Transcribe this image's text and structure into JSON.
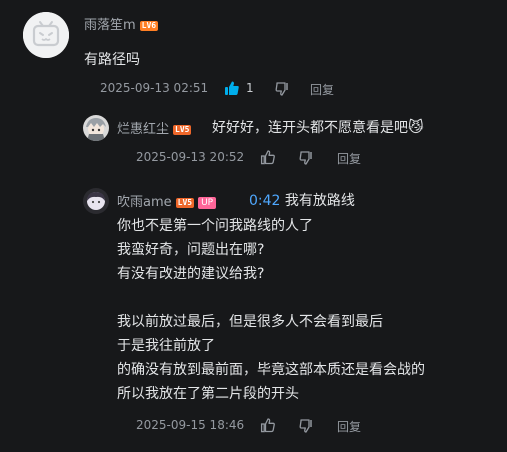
{
  "colors": {
    "background": "#17181a",
    "text": "#e3e5e7",
    "meta": "#9499a0",
    "link": "#4fa8ff",
    "like_active": "#00aeec",
    "up_badge": "#ff6699"
  },
  "comment": {
    "username": "雨落笙m",
    "level": "LV6",
    "text": "有路径吗",
    "time": "2025-09-13 02:51",
    "likes": "1",
    "reply_label": "回复",
    "icons": {
      "avatar": "bilibili-tv-avatar-icon",
      "like": "thumbs-up-filled-icon",
      "dislike": "thumbs-down-icon"
    }
  },
  "replies": [
    {
      "username": "烂惠红尘",
      "level": "LV5",
      "text": "好好好，连开头都不愿意看是吧",
      "emoji": "😼",
      "time": "2025-09-13 20:52",
      "reply_label": "回复"
    },
    {
      "username": "吹雨ame",
      "level": "LV5",
      "badge": "UP",
      "timestamp_link": "0:42",
      "first_line": "我有放路线",
      "lines": [
        "你也不是第一个问我路线的人了",
        "我蛮好奇，问题出在哪?",
        "有没有改进的建议给我?",
        "",
        "我以前放过最后，但是很多人不会看到最后",
        "于是我往前放了",
        "的确没有放到最前面，毕竟这部本质还是看会战的",
        "所以我放在了第二片段的开头"
      ],
      "time": "2025-09-15 18:46",
      "reply_label": "回复"
    }
  ]
}
